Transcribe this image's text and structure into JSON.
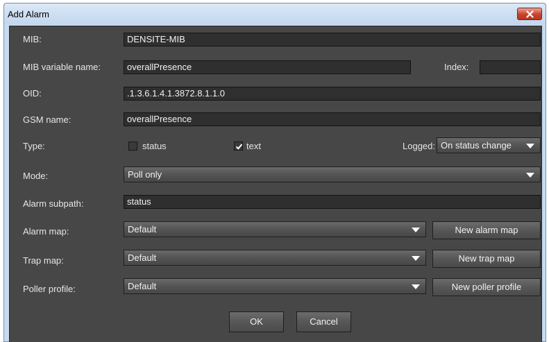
{
  "window": {
    "title": "Add Alarm"
  },
  "form": {
    "mib_label": "MIB:",
    "mib_value": "DENSITE-MIB",
    "varname_label": "MIB variable name:",
    "varname_value": "overallPresence",
    "index_label": "Index:",
    "index_value": "",
    "oid_label": "OID:",
    "oid_value": ".1.3.6.1.4.1.3872.8.1.1.0",
    "gsm_label": "GSM name:",
    "gsm_value": "overallPresence",
    "type_label": "Type:",
    "type_status_label": "status",
    "type_status_checked": false,
    "type_text_label": "text",
    "type_text_checked": true,
    "logged_label": "Logged:",
    "logged_value": "On status change",
    "mode_label": "Mode:",
    "mode_value": "Poll only",
    "subpath_label": "Alarm subpath:",
    "subpath_value": "status",
    "alarmmap_label": "Alarm map:",
    "alarmmap_value": "Default",
    "new_alarm_map": "New alarm map",
    "trapmap_label": "Trap map:",
    "trapmap_value": "Default",
    "new_trap_map": "New trap map",
    "poller_label": "Poller profile:",
    "poller_value": "Default",
    "new_poller_profile": "New poller profile"
  },
  "buttons": {
    "ok": "OK",
    "cancel": "Cancel"
  },
  "icons": {
    "close": "close-icon",
    "dropdown": "chevron-down-icon",
    "check": "check-icon"
  },
  "colors": {
    "panel": "#474747",
    "field": "#2f2f2f",
    "frame": "#c7dbf0",
    "close": "#c7432e"
  }
}
